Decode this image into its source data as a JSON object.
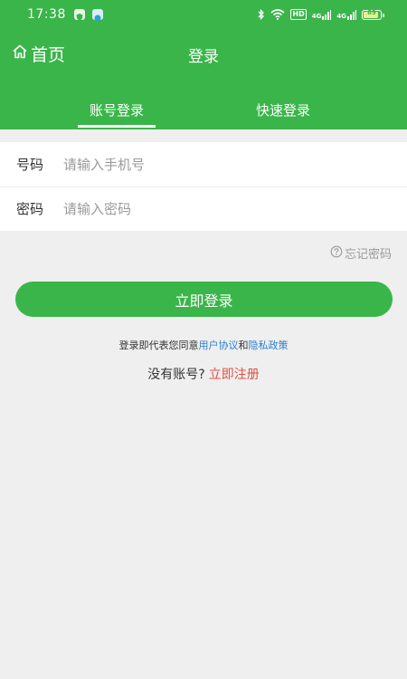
{
  "status_bar": {
    "time": "17:38",
    "signal_label_1": "4G",
    "signal_label_2": "4G",
    "hd_label": "HD",
    "battery": "89"
  },
  "header": {
    "home_label": "首页",
    "title": "登录",
    "tabs": [
      {
        "label": "账号登录",
        "active": true
      },
      {
        "label": "快速登录",
        "active": false
      }
    ]
  },
  "form": {
    "phone_label": "号码",
    "phone_placeholder": "请输入手机号",
    "password_label": "密码",
    "password_placeholder": "请输入密码"
  },
  "forgot_password": "忘记密码",
  "login_button": "立即登录",
  "agreement": {
    "prefix": "登录即代表您同意",
    "user_agreement": "用户协议",
    "and": "和",
    "privacy_policy": "隐私政策"
  },
  "register": {
    "prompt": "没有账号?",
    "link": "立即注册"
  },
  "colors": {
    "primary": "#3ab54a",
    "link": "#2b7fd1",
    "register_link": "#e05040"
  }
}
